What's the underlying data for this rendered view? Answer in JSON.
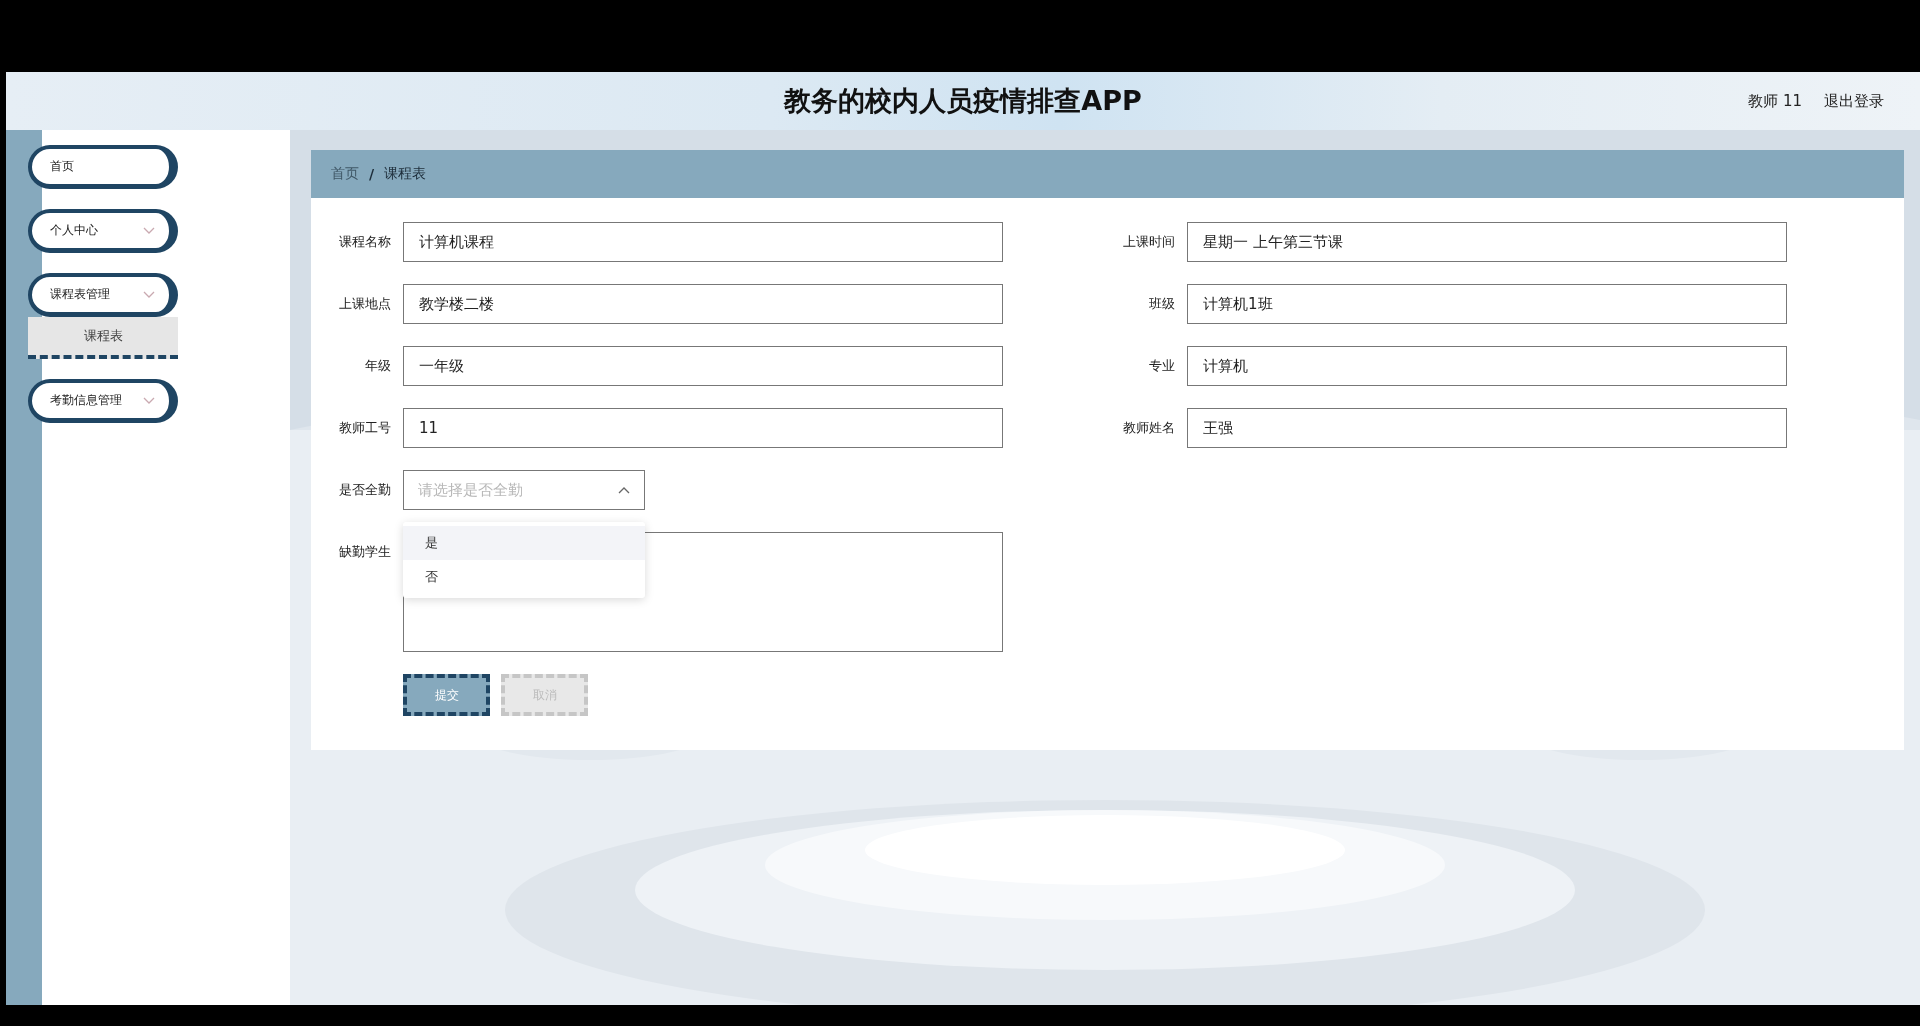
{
  "header": {
    "title": "教务的校内人员疫情排查APP",
    "user": "教师 11",
    "logout": "退出登录"
  },
  "sidebar": {
    "items": [
      {
        "kind": "link",
        "label": "首页"
      },
      {
        "kind": "menu",
        "label": "个人中心"
      },
      {
        "kind": "menu",
        "label": "课程表管理",
        "expanded": true,
        "children": [
          {
            "label": "课程表",
            "selected": true
          }
        ]
      },
      {
        "kind": "menu",
        "label": "考勤信息管理"
      }
    ]
  },
  "breadcrumb": {
    "separator": "/",
    "items": [
      {
        "label": "首页",
        "current": false
      },
      {
        "label": "课程表",
        "current": true
      }
    ]
  },
  "form": {
    "rows": [
      {
        "fields": [
          {
            "kind": "text",
            "label": "课程名称",
            "value": "计算机课程"
          },
          {
            "kind": "text",
            "label": "上课时间",
            "value": "星期一 上午第三节课"
          }
        ]
      },
      {
        "fields": [
          {
            "kind": "text",
            "label": "上课地点",
            "value": "教学楼二楼"
          },
          {
            "kind": "text",
            "label": "班级",
            "value": "计算机1班"
          }
        ]
      },
      {
        "fields": [
          {
            "kind": "text",
            "label": "年级",
            "value": "一年级"
          },
          {
            "kind": "text",
            "label": "专业",
            "value": "计算机"
          }
        ]
      },
      {
        "fields": [
          {
            "kind": "text",
            "label": "教师工号",
            "value": "11"
          },
          {
            "kind": "text",
            "label": "教师姓名",
            "value": "王强"
          }
        ]
      },
      {
        "fields": [
          {
            "kind": "select",
            "label": "是否全勤",
            "placeholder": "请选择是否全勤",
            "expanded": true,
            "options": [
              {
                "label": "是",
                "hovered": true
              },
              {
                "label": "否",
                "hovered": false
              }
            ]
          }
        ]
      },
      {
        "fields": [
          {
            "kind": "textarea",
            "label": "缺勤学生"
          }
        ]
      }
    ],
    "buttons": [
      {
        "kind": "primary",
        "label": "提交"
      },
      {
        "kind": "secondary",
        "label": "取消"
      }
    ]
  }
}
